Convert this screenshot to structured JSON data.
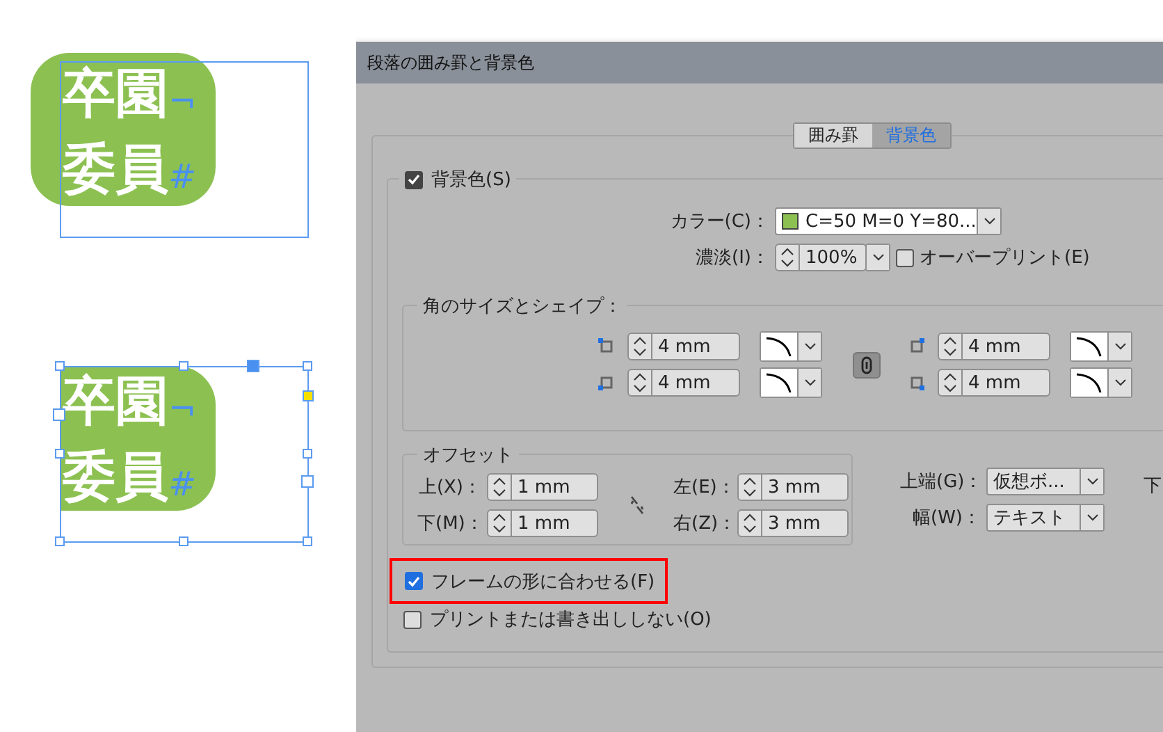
{
  "canvas": {
    "frames": [
      {
        "lines": [
          {
            "text": "卒園",
            "mark": "¬"
          },
          {
            "text": "委員",
            "mark": "#"
          }
        ],
        "selected": false,
        "fit_frame": false
      },
      {
        "lines": [
          {
            "text": "卒園",
            "mark": "¬"
          },
          {
            "text": "委員",
            "mark": "#"
          }
        ],
        "selected": true,
        "fit_frame": true
      }
    ]
  },
  "dialog": {
    "title": "段落の囲み罫と背景色",
    "tabs": [
      {
        "label": "囲み罫",
        "selected": false
      },
      {
        "label": "背景色",
        "selected": true
      }
    ],
    "background": {
      "label": "背景色(S)",
      "checked": true,
      "color": {
        "label": "カラー(C)：",
        "value": "C=50 M=0 Y=80..."
      },
      "tint": {
        "label": "濃淡(I)：",
        "value": "100%"
      },
      "overprint": {
        "label": "オーバープリント(E)",
        "checked": false
      },
      "corners": {
        "title": "角のサイズとシェイプ：",
        "linked": true,
        "items": [
          {
            "value": "4 mm"
          },
          {
            "value": "4 mm"
          },
          {
            "value": "4 mm"
          },
          {
            "value": "4 mm"
          }
        ]
      },
      "offset": {
        "title": "オフセット",
        "linked": false,
        "fields": [
          {
            "label": "上(X)：",
            "value": "1 mm"
          },
          {
            "label": "左(E)：",
            "value": "3 mm"
          },
          {
            "label": "下(M)：",
            "value": "1 mm"
          },
          {
            "label": "右(Z)：",
            "value": "3 mm"
          }
        ]
      },
      "top_edge": {
        "label": "上端(G)：",
        "value": "仮想ボ..."
      },
      "width": {
        "label": "幅(W)：",
        "value": "テキスト"
      },
      "bottom_edge_label": "下",
      "options": [
        {
          "label": "フレームの形に合わせる(F)",
          "checked": true,
          "highlighted": true
        },
        {
          "label": "プリントまたは書き出ししない(O)",
          "checked": false,
          "highlighted": false
        }
      ]
    }
  }
}
